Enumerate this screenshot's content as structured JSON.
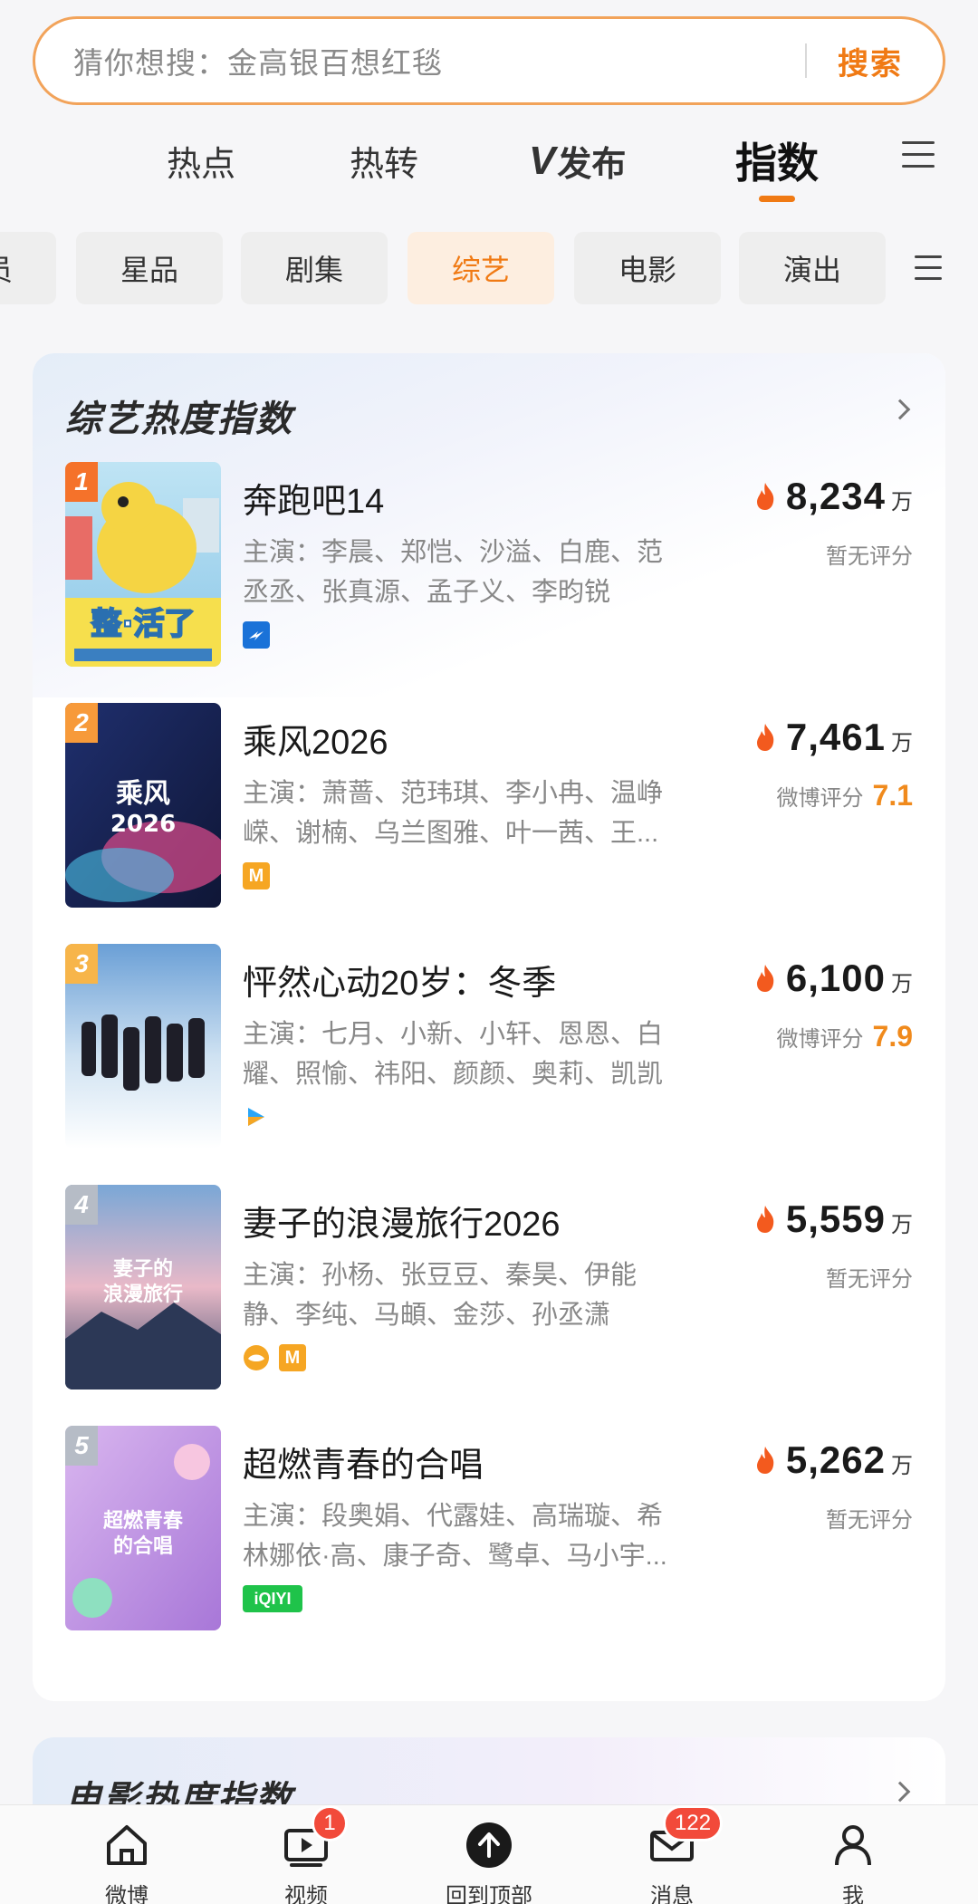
{
  "search": {
    "placeholder": "猜你想搜：金高银百想红毯",
    "button": "搜索"
  },
  "main_tabs": {
    "hot": "热点",
    "repost": "热转",
    "vpub_logo": "V",
    "vpub": "发布",
    "index": "指数"
  },
  "chips": [
    "员",
    "星品",
    "剧集",
    "综艺",
    "电影",
    "演出"
  ],
  "chips_active": "综艺",
  "variety_card": {
    "title": "综艺热度指数",
    "items": [
      {
        "rank": "1",
        "name": "奔跑吧14",
        "cast_line1": "主演：李晨、郑恺、沙溢、白鹿、范",
        "cast_line2": "丞丞、张真源、孟子义、李昀锐",
        "heat": "8,234",
        "unit": "万",
        "rating_label": "暂无评分",
        "score": "",
        "poster_text": "整·活了",
        "platforms": [
          "zhejiang-tv"
        ]
      },
      {
        "rank": "2",
        "name": "乘风2026",
        "cast_line1": "主演：萧蔷、范玮琪、李小冉、温峥",
        "cast_line2": "嵘、谢楠、乌兰图雅、叶一茜、王...",
        "heat": "7,461",
        "unit": "万",
        "rating_label": "微博评分",
        "score": "7.1",
        "poster_text": "乘风\n2026",
        "platforms": [
          "mango-tv"
        ]
      },
      {
        "rank": "3",
        "name": "怦然心动20岁：冬季",
        "cast_line1": "主演：七月、小新、小轩、恩恩、白",
        "cast_line2": "耀、照愉、祎阳、颜颜、奥莉、凯凯",
        "heat": "6,100",
        "unit": "万",
        "rating_label": "微博评分",
        "score": "7.9",
        "poster_text": "",
        "platforms": [
          "youku"
        ]
      },
      {
        "rank": "4",
        "name": "妻子的浪漫旅行2026",
        "cast_line1": "主演：孙杨、张豆豆、秦昊、伊能",
        "cast_line2": "静、李纯、马頔、金莎、孙丞潇",
        "heat": "5,559",
        "unit": "万",
        "rating_label": "暂无评分",
        "score": "",
        "poster_text": "妻子的\n浪漫旅行",
        "platforms": [
          "hunan-tv",
          "mango-tv"
        ]
      },
      {
        "rank": "5",
        "name": "超燃青春的合唱",
        "cast_line1": "主演：段奥娟、代露娃、高瑞璇、希",
        "cast_line2": "林娜依·高、康子奇、鹭卓、马小宇...",
        "heat": "5,262",
        "unit": "万",
        "rating_label": "暂无评分",
        "score": "",
        "poster_text": "超燃青春\n的合唱",
        "platforms": [
          "iqiyi"
        ]
      }
    ]
  },
  "movie_card": {
    "title": "电影热度指数"
  },
  "platform_labels": {
    "iqiyi": "iQIYI",
    "mango": "M"
  },
  "bottom_nav": {
    "weibo": "微博",
    "video": "视频",
    "video_badge": "1",
    "top": "回到顶部",
    "messages": "消息",
    "messages_badge": "122",
    "me": "我"
  },
  "colors": {
    "accent": "#f07a14",
    "rank1": "#f5722a",
    "rank2": "#f79a3a",
    "rank3": "#f7b54a",
    "rank_other": "#b6bcc6",
    "badge": "#f24a3a",
    "score": "#f08a1c"
  }
}
